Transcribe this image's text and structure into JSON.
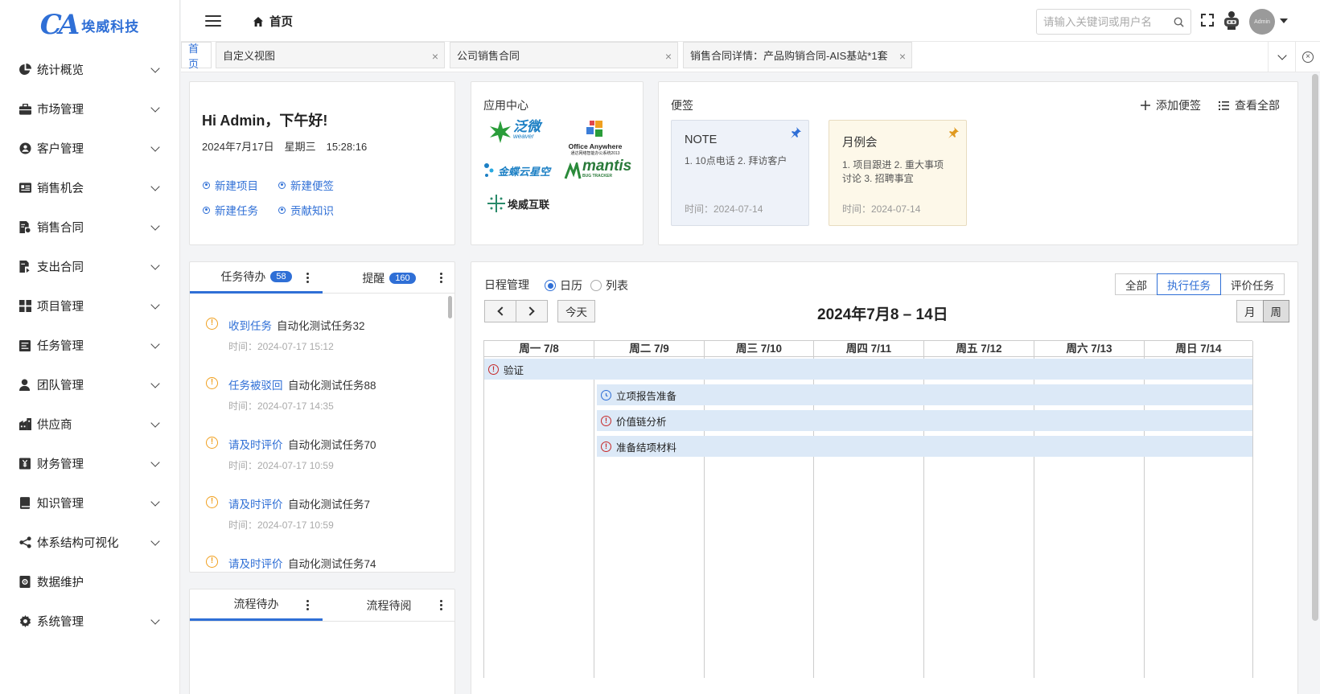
{
  "brand": {
    "name": "埃威科技"
  },
  "sidebar": {
    "items": [
      {
        "label": "统计概览"
      },
      {
        "label": "市场管理"
      },
      {
        "label": "客户管理"
      },
      {
        "label": "销售机会"
      },
      {
        "label": "销售合同"
      },
      {
        "label": "支出合同"
      },
      {
        "label": "项目管理"
      },
      {
        "label": "任务管理"
      },
      {
        "label": "团队管理"
      },
      {
        "label": "供应商"
      },
      {
        "label": "财务管理"
      },
      {
        "label": "知识管理"
      },
      {
        "label": "体系结构可视化"
      },
      {
        "label": "数据维护"
      },
      {
        "label": "系统管理"
      }
    ]
  },
  "header": {
    "breadcrumb": "首页",
    "search_placeholder": "请输入关键词或用户名",
    "avatar_label": "Admin"
  },
  "tabs": [
    {
      "label": "首页"
    },
    {
      "label": "自定义视图"
    },
    {
      "label": "公司销售合同"
    },
    {
      "label": "销售合同详情：产品购销合同-AIS基站*1套"
    }
  ],
  "greeting": {
    "title": "Hi Admin，下午好!",
    "datetime": "2024年7月17日　星期三　15:28:16",
    "actions": [
      "新建项目",
      "新建便签",
      "新建任务",
      "贡献知识"
    ]
  },
  "app_center": {
    "title": "应用中心",
    "apps": [
      "泛微",
      "Office Anywhere",
      "金蝶云星空",
      "mantis",
      "埃威互联"
    ],
    "subtitles": {
      "weaver": "weaver",
      "oa": "通达网络智能办公系统2013",
      "mantis": "BUG TRACKER"
    }
  },
  "notes": {
    "title": "便签",
    "add_label": "添加便签",
    "view_all_label": "查看全部",
    "items": [
      {
        "title": "NOTE",
        "body": "1. 10点电话 2. 拜访客户",
        "time": "时间：2024-07-14",
        "bg": "#eef2f9",
        "pin_color": "#2f6fd6"
      },
      {
        "title": "月例会",
        "body": "1. 项目跟进 2. 重大事项讨论 3. 招聘事宜",
        "time": "时间：2024-07-14",
        "bg": "#fdf8e9",
        "pin_color": "#e09a20"
      }
    ]
  },
  "tasks": {
    "tab_todo": "任务待办",
    "todo_count": "58",
    "tab_remind": "提醒",
    "remind_count": "160",
    "items": [
      {
        "kind": "收到任务",
        "name": "自动化测试任务32",
        "time": "时间：2024-07-17 15:12"
      },
      {
        "kind": "任务被驳回",
        "name": "自动化测试任务88",
        "time": "时间：2024-07-17 14:35"
      },
      {
        "kind": "请及时评价",
        "name": "自动化测试任务70",
        "time": "时间：2024-07-17 10:59"
      },
      {
        "kind": "请及时评价",
        "name": "自动化测试任务7",
        "time": "时间：2024-07-17 10:59"
      },
      {
        "kind": "请及时评价",
        "name": "自动化测试任务74",
        "time": ""
      }
    ]
  },
  "flow": {
    "tab_todo": "流程待办",
    "tab_read": "流程待阅"
  },
  "schedule": {
    "title": "日程管理",
    "view_calendar": "日历",
    "view_list": "列表",
    "filters": [
      "全部",
      "执行任务",
      "评价任务"
    ],
    "today": "今天",
    "range_title": "2024年7月8 – 14日",
    "modes": [
      "月",
      "周"
    ],
    "days": [
      "周一 7/8",
      "周二 7/9",
      "周三 7/10",
      "周四 7/11",
      "周五 7/12",
      "周六 7/13",
      "周日 7/14"
    ],
    "events": [
      {
        "label": "验证",
        "icon": "!"
      },
      {
        "label": "立项报告准备",
        "icon": "clock"
      },
      {
        "label": "价值链分析",
        "icon": "!"
      },
      {
        "label": "准备结项材料",
        "icon": "!"
      }
    ]
  },
  "colors": {
    "accent": "#2f6fd6",
    "warn": "#f0a020",
    "danger": "#c62828",
    "event_bg": "#dce9f7"
  }
}
